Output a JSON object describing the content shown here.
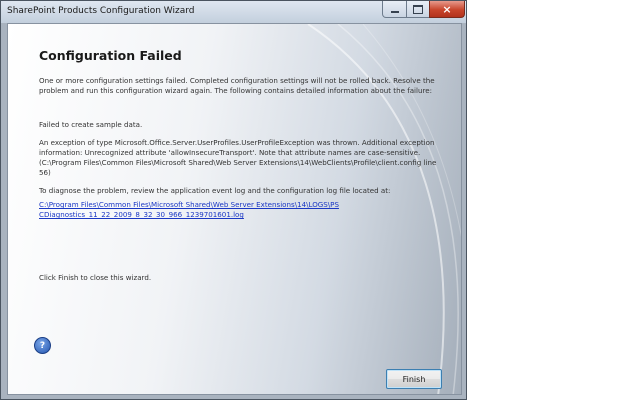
{
  "window": {
    "title": "SharePoint Products Configuration Wizard"
  },
  "main": {
    "heading": "Configuration Failed",
    "summary": "One or more configuration settings failed.  Completed configuration settings will not be rolled back.  Resolve the problem and run this configuration wizard again.  The following contains detailed information about the failure:",
    "failed_line": "Failed to create sample data.",
    "exception_text": "An exception of type Microsoft.Office.Server.UserProfiles.UserProfileException was thrown.  Additional exception information: Unrecognized attribute 'allowInsecureTransport'. Note that attribute names are case-sensitive. (C:\\Program Files\\Common Files\\Microsoft Shared\\Web Server Extensions\\14\\WebClients\\Profile\\client.config line 56)",
    "diagnose_text": "To diagnose the problem, review the application event log and the configuration log file located at:",
    "log_link": "C:\\Program Files\\Common Files\\Microsoft Shared\\Web Server Extensions\\14\\LOGS\\PSCDiagnostics_11_22_2009_8_32_30_966_1239701601.log",
    "finish_instruction": "Click Finish to close this wizard."
  },
  "buttons": {
    "help_glyph": "?",
    "finish": "Finish",
    "close_glyph": "×"
  },
  "icons": {
    "help": "help-icon",
    "minimize": "minimize-icon",
    "maximize": "maximize-icon",
    "close": "close-icon"
  },
  "colors": {
    "link": "#1a37c4",
    "close_button": "#c8452c",
    "help_icon": "#2456b0"
  }
}
